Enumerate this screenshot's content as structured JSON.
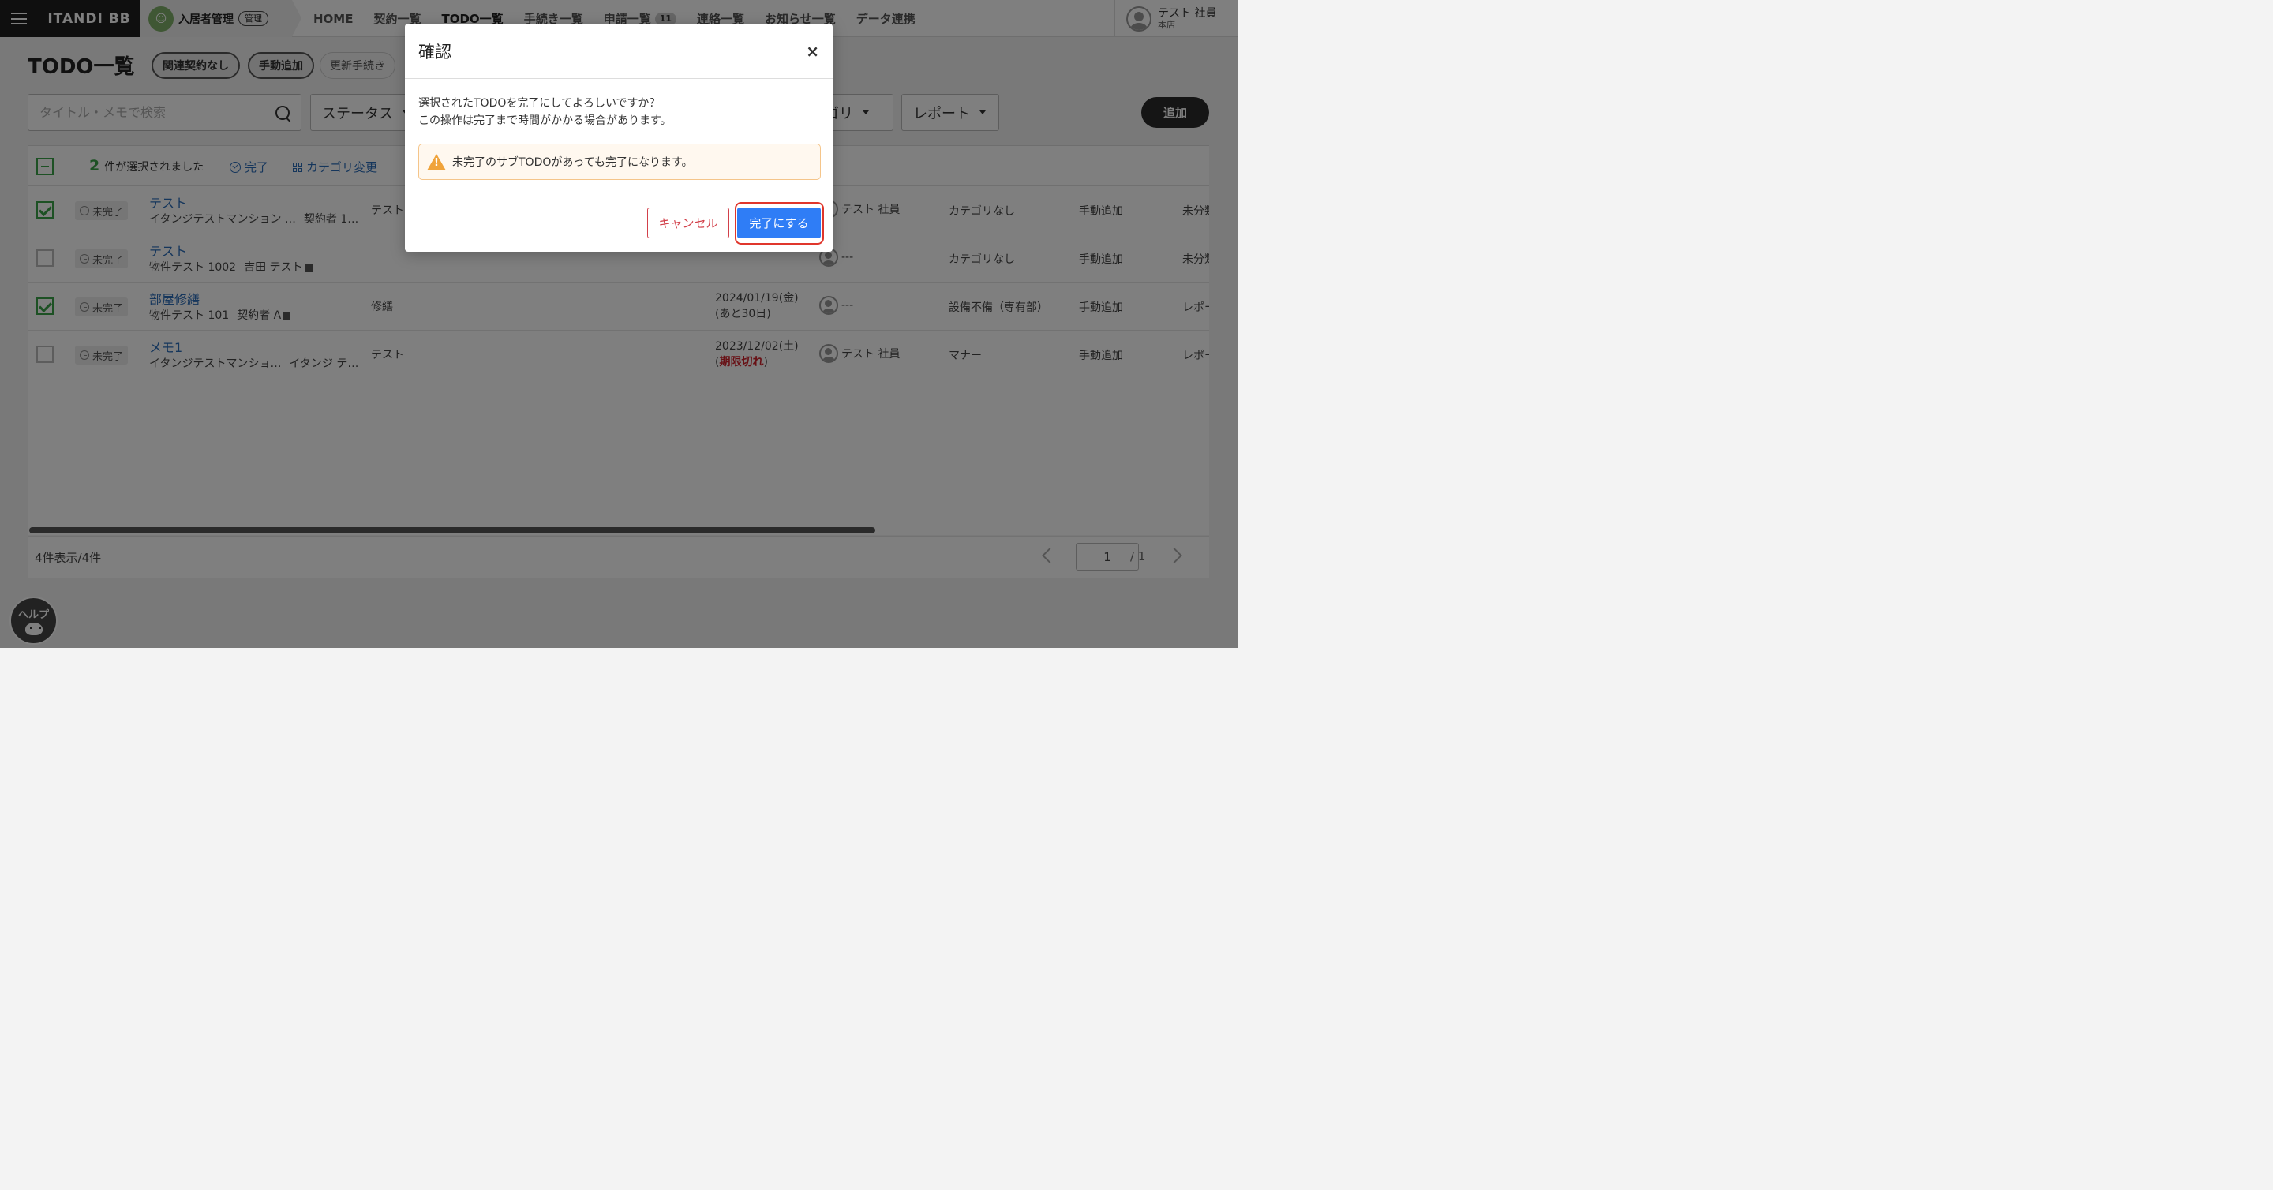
{
  "header": {
    "logo": "ITANDI BB",
    "product_logo_glyph": "☺",
    "product_name": "入居者管理",
    "product_badge": "管理",
    "nav": [
      {
        "label": "HOME"
      },
      {
        "label": "契約一覧"
      },
      {
        "label": "TODO一覧"
      },
      {
        "label": "手続き一覧"
      },
      {
        "label": "申請一覧",
        "badge": "11"
      },
      {
        "label": "連絡一覧"
      },
      {
        "label": "お知らせ一覧"
      },
      {
        "label": "データ連携"
      }
    ],
    "user": {
      "name": "テスト 社員",
      "store": "本店"
    }
  },
  "page": {
    "title": "TODO一覧",
    "chips": [
      "関連契約なし",
      "手動追加",
      "更新手続き"
    ],
    "search_placeholder": "タイトル・メモで検索",
    "filters": {
      "status": "ステータス",
      "category_partial": "ゴリ",
      "report": "レポート"
    },
    "add_label": "追加"
  },
  "selection": {
    "count": "2",
    "count_suffix": "件が選択されました",
    "complete_label": "完了",
    "category_change_label": "カテゴリ変更"
  },
  "rows": [
    {
      "checked": true,
      "status": "未完了",
      "title": "テスト",
      "sub1": "イタンジテストマンション …",
      "sub2": "契約者 1…",
      "category": "テスト",
      "due1": "",
      "due2": "",
      "assignee": "テスト 社員",
      "cat": "カテゴリなし",
      "source": "手動追加",
      "report": "未分類"
    },
    {
      "checked": false,
      "status": "未完了",
      "title": "テスト",
      "sub1": "物件テスト 1002",
      "sub2": "吉田 テスト",
      "category": "",
      "due1": "",
      "due2": "",
      "assignee": "---",
      "cat": "カテゴリなし",
      "source": "手動追加",
      "report": "未分類"
    },
    {
      "checked": true,
      "status": "未完了",
      "title": "部屋修繕",
      "sub1": "物件テスト 101",
      "sub2": "契約者 A",
      "category": "修繕",
      "due1": "2024/01/19(金)",
      "due2": "(あと30日)",
      "assignee": "---",
      "cat": "設備不備（専有部）",
      "source": "手動追加",
      "report": "レポート"
    },
    {
      "checked": false,
      "status": "未完了",
      "title": "メモ1",
      "sub1": "イタンジテストマンショ…",
      "sub2": "イタンジ テ…",
      "category": "テスト",
      "due1": "2023/12/02(土)",
      "due2_open": "(",
      "due2_expired": "期限切れ",
      "due2_close": ")",
      "assignee": "テスト 社員",
      "cat": "マナー",
      "source": "手動追加",
      "report": "レポート"
    }
  ],
  "footer": {
    "count": "4件表示/4件",
    "page_value": "1",
    "total": "/ 1"
  },
  "help": {
    "label": "ヘルプ"
  },
  "modal": {
    "title": "確認",
    "close": "×",
    "message_line1": "選択されたTODOを完了にしてよろしいですか？",
    "message_line2": "この操作は完了まで時間がかかる場合があります。",
    "warning": "未完了のサブTODOがあっても完了になります。",
    "cancel": "キャンセル",
    "confirm": "完了にする"
  },
  "colors": {
    "primary": "#2f7df6",
    "danger": "#d2404a",
    "success": "#3aa348",
    "link": "#2b6cb8"
  }
}
